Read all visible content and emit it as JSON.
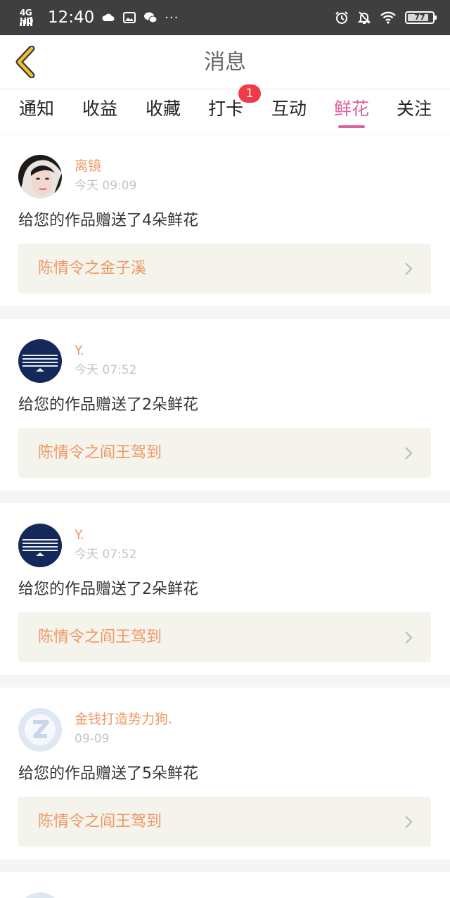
{
  "status_bar": {
    "network": "4G HD",
    "time": "12:40",
    "dots": "···",
    "battery": "77",
    "icons": [
      "signal-icon",
      "weather-icon",
      "gallery-icon",
      "wechat-icon",
      "alarm-icon",
      "mute-icon",
      "wifi-icon",
      "battery-icon"
    ]
  },
  "header": {
    "title": "消息",
    "back_icon": "chevron-left-icon"
  },
  "tabs": [
    {
      "label": "通知",
      "active": false
    },
    {
      "label": "收益",
      "active": false
    },
    {
      "label": "收藏",
      "active": false
    },
    {
      "label": "打卡",
      "active": false,
      "badge": "1"
    },
    {
      "label": "互动",
      "active": false
    },
    {
      "label": "鲜花",
      "active": true
    },
    {
      "label": "关注",
      "active": false
    }
  ],
  "colors": {
    "accent": "#e0609a",
    "name": "#ef9865",
    "badge": "#ef3b47",
    "work_box": "#f4f4ec"
  },
  "items": [
    {
      "user": "离镜",
      "time": "今天 09:09",
      "message": "给您的作品赠送了4朵鲜花",
      "work": "陈情令之金子溪",
      "avatar": "photo"
    },
    {
      "user": "Y.",
      "time": "今天 07:52",
      "message": "给您的作品赠送了2朵鲜花",
      "work": "陈情令之阎王驾到",
      "avatar": "navy"
    },
    {
      "user": "Y.",
      "time": "今天 07:52",
      "message": "给您的作品赠送了2朵鲜花",
      "work": "陈情令之阎王驾到",
      "avatar": "navy"
    },
    {
      "user": "金钱打造势力狗.",
      "time": "09-09",
      "message": "给您的作品赠送了5朵鲜花",
      "work": "陈情令之阎王驾到",
      "avatar": "default"
    }
  ]
}
